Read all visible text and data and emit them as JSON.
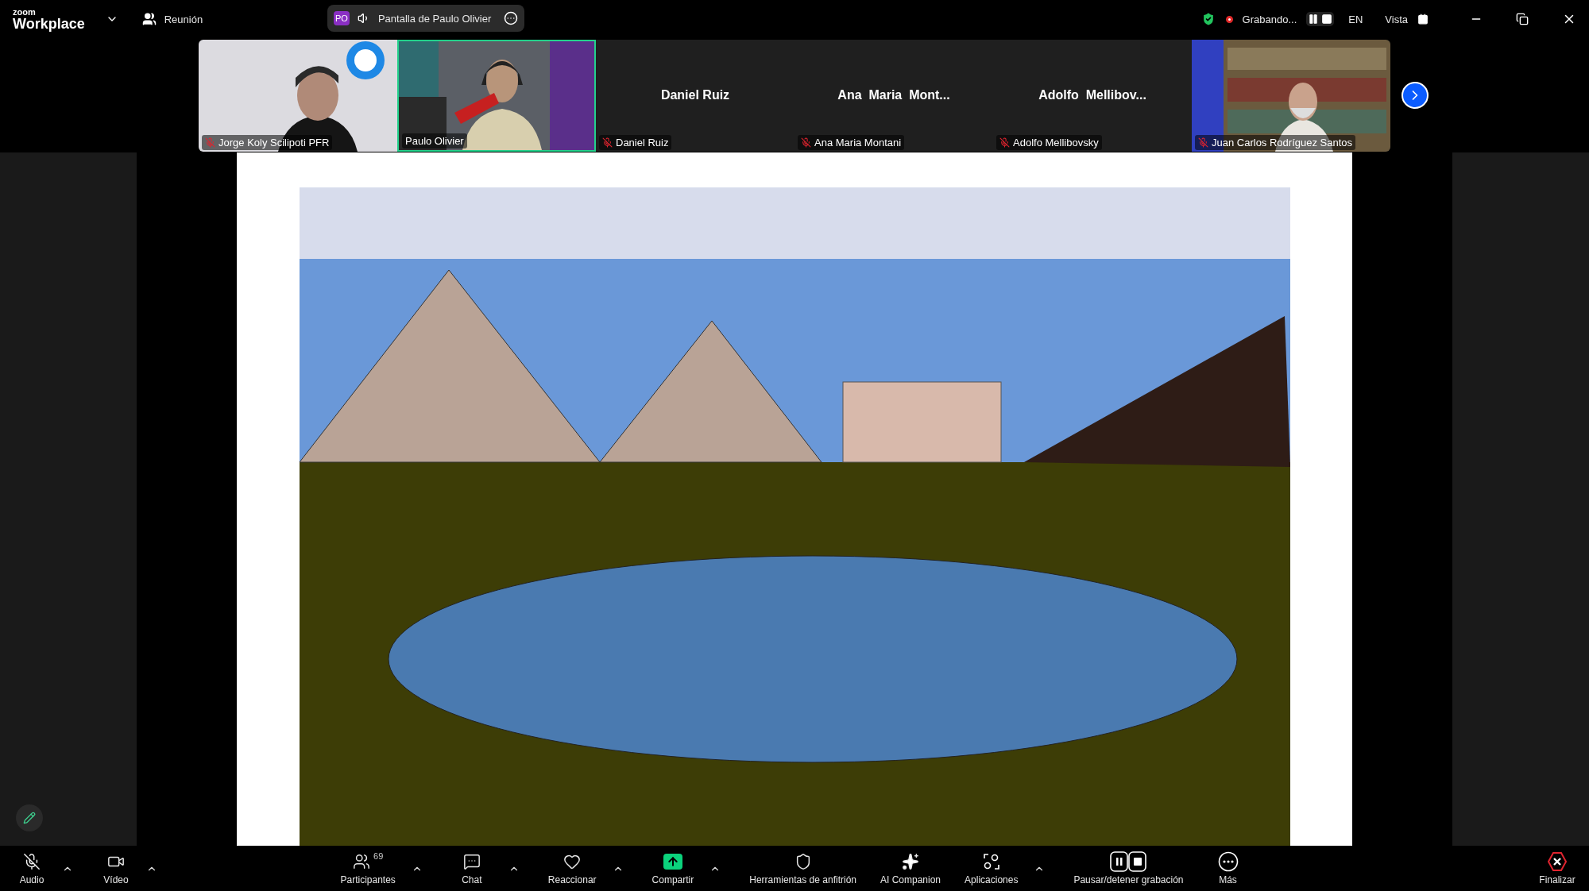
{
  "top_bar": {
    "brand_small": "zoom",
    "brand": "Workplace",
    "meeting": "Reunión",
    "share": {
      "initials": "PO",
      "label": "Pantalla de Paulo Olivier"
    },
    "recording": {
      "label": "Grabando..."
    },
    "language": "EN",
    "view": "Vista"
  },
  "participants": [
    {
      "name": "Jorge Koly Scilipoti PFR",
      "kind": "video",
      "muted": true,
      "speaking": false
    },
    {
      "name": "Paulo Olivier",
      "kind": "video",
      "muted": false,
      "speaking": true
    },
    {
      "name": "Daniel Ruiz",
      "kind": "name",
      "display": "Daniel Ruiz",
      "muted": true,
      "speaking": false
    },
    {
      "name": "Ana Maria Montani",
      "kind": "name",
      "display": "Ana  Maria  Mont...",
      "muted": true,
      "speaking": false
    },
    {
      "name": "Adolfo Mellibovsky",
      "kind": "name",
      "display": "Adolfo  Mellibov...",
      "muted": true,
      "speaking": false
    },
    {
      "name": "Juan Carlos Rodríguez Santos",
      "kind": "video",
      "muted": true,
      "speaking": false
    }
  ],
  "toolbar": {
    "left": [
      {
        "label": "Audio",
        "kind": "audio",
        "muted": true,
        "caret": true
      },
      {
        "label": "Vídeo",
        "kind": "video",
        "caret": true
      }
    ],
    "center": [
      {
        "label": "Participantes",
        "kind": "participants",
        "badge": "69",
        "caret": true
      },
      {
        "label": "Chat",
        "kind": "chat",
        "caret": true
      },
      {
        "label": "Reaccionar",
        "kind": "react",
        "caret": true
      },
      {
        "label": "Compartir",
        "kind": "share",
        "caret": true
      },
      {
        "label": "Herramientas de anfitrión",
        "kind": "host"
      },
      {
        "label": "AI Companion",
        "kind": "ai"
      },
      {
        "label": "Aplicaciones",
        "kind": "apps",
        "caret": true
      },
      {
        "label": "Pausar/detener grabación",
        "kind": "record"
      },
      {
        "label": "Más",
        "kind": "more"
      }
    ],
    "right": [
      {
        "label": "Finalizar",
        "kind": "end"
      }
    ]
  }
}
